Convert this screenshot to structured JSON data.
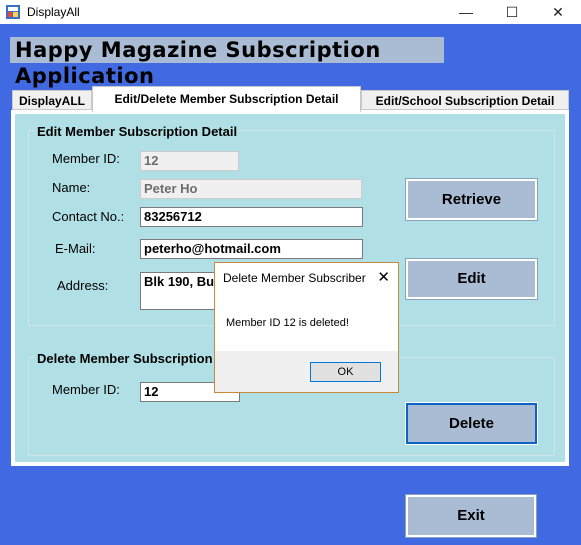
{
  "window": {
    "title": "DisplayAll",
    "minimize": "—",
    "maximize": "☐",
    "close": "✕"
  },
  "banner": {
    "title": "Happy Magazine Subscription Application"
  },
  "tabs": [
    {
      "label": "DisplayALL"
    },
    {
      "label": "Edit/Delete Member Subscription Detail"
    },
    {
      "label": "Edit/School Subscription Detail"
    }
  ],
  "edit_group": {
    "title": "Edit Member Subscription Detail",
    "member_id_label": "Member ID:",
    "member_id_value": "12",
    "name_label": "Name:",
    "name_value": "Peter Ho",
    "contact_label": "Contact No.:",
    "contact_value": "83256712",
    "email_label": "E-Mail:",
    "email_value": "peterho@hotmail.com",
    "address_label": "Address:",
    "address_value": "Blk 190, Bu"
  },
  "delete_group": {
    "title": "Delete Member Subscription",
    "member_id_label": "Member ID:",
    "member_id_value": "12"
  },
  "buttons": {
    "retrieve": "Retrieve",
    "edit": "Edit",
    "delete": "Delete",
    "exit": "Exit"
  },
  "dialog": {
    "title": "Delete Member Subscriber",
    "close": "✕",
    "message": "Member ID 12 is deleted!",
    "ok": "OK"
  }
}
